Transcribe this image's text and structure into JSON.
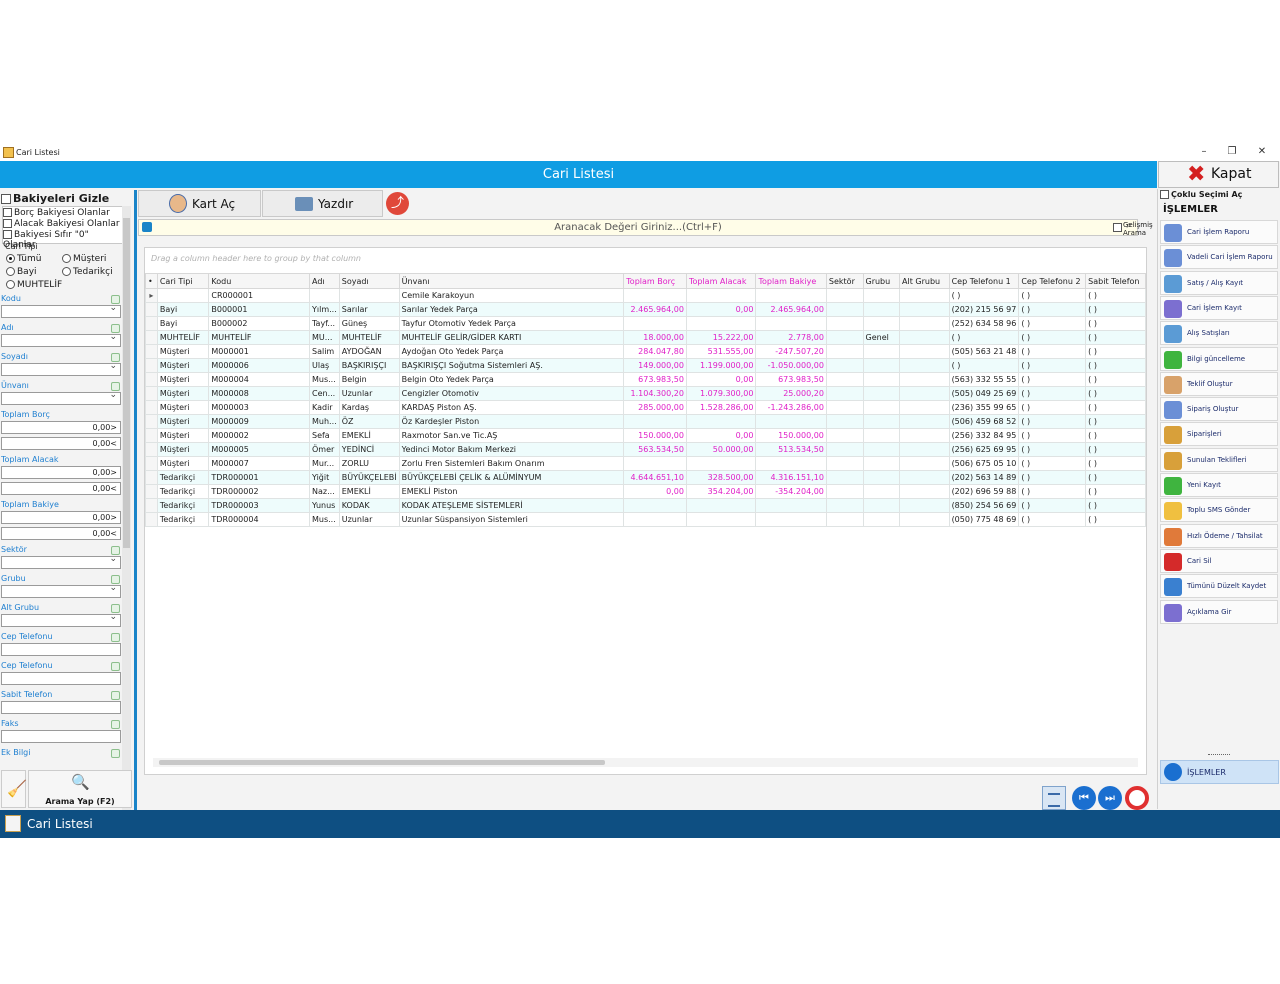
{
  "window": {
    "title": "Cari Listesi",
    "header": "Cari Listesi",
    "close_label": "Kapat"
  },
  "left": {
    "hide_balances": "Bakiyeleri Gizle",
    "filters": [
      "Borç Bakiyesi Olanlar",
      "Alacak Bakiyesi Olanlar",
      "Bakiyesi Sıfır \"0\" Olanlar"
    ],
    "cari_tipi_label": "Cari Tipi",
    "radios": [
      "Tümü",
      "Müşteri",
      "Bayi",
      "Tedarikçi",
      "MUHTELİF"
    ],
    "fields": [
      {
        "label": "Kodu",
        "type": "dd"
      },
      {
        "label": "Adı",
        "type": "dd"
      },
      {
        "label": "Soyadı",
        "type": "dd"
      },
      {
        "label": "Ünvanı",
        "type": "dd"
      },
      {
        "label": "Toplam Borç",
        "type": "range",
        "v1": "0,00>",
        "v2": "0,00<"
      },
      {
        "label": "Toplam Alacak",
        "type": "range",
        "v1": "0,00>",
        "v2": "0,00<"
      },
      {
        "label": "Toplam Bakiye",
        "type": "range",
        "v1": "0,00>",
        "v2": "0,00<"
      },
      {
        "label": "Sektör",
        "type": "dd"
      },
      {
        "label": "Grubu",
        "type": "dd"
      },
      {
        "label": "Alt Grubu",
        "type": "dd"
      },
      {
        "label": "Cep Telefonu",
        "type": "text"
      },
      {
        "label": "Cep Telefonu",
        "type": "text"
      },
      {
        "label": "Sabit Telefon",
        "type": "text"
      },
      {
        "label": "Faks",
        "type": "text"
      },
      {
        "label": "Ek Bilgi",
        "type": "text"
      }
    ],
    "search_button": "Arama Yap (F2)"
  },
  "toolbar": {
    "open_card": "Kart Aç",
    "print": "Yazdır",
    "search_placeholder": "Aranacak Değeri Giriniz...(Ctrl+F)",
    "advanced": "Gelişmiş Arama"
  },
  "grid": {
    "groupby_hint": "Drag a column header here to group by that column",
    "columns": [
      "Cari Tipi",
      "Kodu",
      "Adı",
      "Soyadı",
      "Ünvanı",
      "Toplam Borç",
      "Toplam Alacak",
      "Toplam Bakiye",
      "Sektör",
      "Grubu",
      "Alt Grubu",
      "Cep Telefonu 1",
      "Cep Telefonu 2",
      "Sabit Telefon"
    ],
    "rows": [
      [
        "",
        "CR000001",
        "",
        "",
        "Cemile Karakoyun",
        "",
        "",
        "",
        "",
        "",
        "",
        "( )",
        "( )",
        "( )"
      ],
      [
        "Bayi",
        "B000001",
        "Yılm...",
        "Sarılar",
        "Sarılar Yedek Parça",
        "2.465.964,00",
        "0,00",
        "2.465.964,00",
        "",
        "",
        "",
        "(202) 215 56 97",
        "( )",
        "( )"
      ],
      [
        "Bayi",
        "B000002",
        "Tayf...",
        "Güneş",
        "Tayfur Otomotiv Yedek Parça",
        "",
        "",
        "",
        "",
        "",
        "",
        "(252) 634 58 96",
        "( )",
        "( )"
      ],
      [
        "MUHTELİF",
        "MUHTELİF",
        "MU...",
        "MUHTELİF",
        "MUHTELİF GELİR/GİDER KARTI",
        "18.000,00",
        "15.222,00",
        "2.778,00",
        "",
        "Genel",
        "",
        "( )",
        "( )",
        "( )"
      ],
      [
        "Müşteri",
        "M000001",
        "Salim",
        "AYDOĞAN",
        "Aydoğan Oto Yedek Parça",
        "284.047,80",
        "531.555,00",
        "-247.507,20",
        "",
        "",
        "",
        "(505) 563 21 48",
        "( )",
        "( )"
      ],
      [
        "Müşteri",
        "M000006",
        "Ulaş",
        "BAŞKIRIŞÇI",
        "BAŞKIRIŞÇI Soğutma Sistemleri AŞ.",
        "149.000,00",
        "1.199.000,00",
        "-1.050.000,00",
        "",
        "",
        "",
        "( )",
        "( )",
        "( )"
      ],
      [
        "Müşteri",
        "M000004",
        "Mus...",
        "Belgin",
        "Belgin Oto Yedek Parça",
        "673.983,50",
        "0,00",
        "673.983,50",
        "",
        "",
        "",
        "(563) 332 55 55",
        "( )",
        "( )"
      ],
      [
        "Müşteri",
        "M000008",
        "Cen...",
        "Uzunlar",
        "Cengizler Otomotiv",
        "1.104.300,20",
        "1.079.300,00",
        "25.000,20",
        "",
        "",
        "",
        "(505) 049 25 69",
        "( )",
        "( )"
      ],
      [
        "Müşteri",
        "M000003",
        "Kadir",
        "Kardaş",
        "KARDAŞ Piston AŞ.",
        "285.000,00",
        "1.528.286,00",
        "-1.243.286,00",
        "",
        "",
        "",
        "(236) 355 99 65",
        "( )",
        "( )"
      ],
      [
        "Müşteri",
        "M000009",
        "Muh...",
        "ÖZ",
        "Öz Kardeşler Piston",
        "",
        "",
        "",
        "",
        "",
        "",
        "(506) 459 68 52",
        "( )",
        "( )"
      ],
      [
        "Müşteri",
        "M000002",
        "Sefa",
        "EMEKLİ",
        "Raxmotor San.ve Tic.AŞ",
        "150.000,00",
        "0,00",
        "150.000,00",
        "",
        "",
        "",
        "(256) 332 84 95",
        "( )",
        "( )"
      ],
      [
        "Müşteri",
        "M000005",
        "Ömer",
        "YEDİNCİ",
        "Yedinci Motor Bakım Merkezi",
        "563.534,50",
        "50.000,00",
        "513.534,50",
        "",
        "",
        "",
        "(256) 625 69 95",
        "( )",
        "( )"
      ],
      [
        "Müşteri",
        "M000007",
        "Mur...",
        "ZORLU",
        "Zorlu Fren Sistemleri Bakım Onarım",
        "",
        "",
        "",
        "",
        "",
        "",
        "(506) 675 05 10",
        "( )",
        "( )"
      ],
      [
        "Tedarikçi",
        "TDR000001",
        "Yiğit",
        "BÜYÜKÇELEBİ",
        "BÜYÜKÇELEBİ ÇELİK & ALÜMİNYUM",
        "4.644.651,10",
        "328.500,00",
        "4.316.151,10",
        "",
        "",
        "",
        "(202) 563 14 89",
        "( )",
        "( )"
      ],
      [
        "Tedarikçi",
        "TDR000002",
        "Naz...",
        "EMEKLİ",
        "EMEKLİ Piston",
        "0,00",
        "354.204,00",
        "-354.204,00",
        "",
        "",
        "",
        "(202) 696 59 88",
        "( )",
        "( )"
      ],
      [
        "Tedarikçi",
        "TDR000003",
        "Yunus",
        "KODAK",
        "KODAK ATEŞLEME SİSTEMLERİ",
        "",
        "",
        "",
        "",
        "",
        "",
        "(850) 254 56 69",
        "( )",
        "( )"
      ],
      [
        "Tedarikçi",
        "TDR000004",
        "Mus...",
        "Uzunlar",
        "Uzunlar Süspansiyon Sistemleri",
        "",
        "",
        "",
        "",
        "",
        "",
        "(050) 775 48 69",
        "( )",
        "( )"
      ]
    ]
  },
  "right": {
    "multi_select": "Çoklu Seçimi Aç",
    "section": "İŞLEMLER",
    "items": [
      {
        "label": "Cari İşlem Raporu",
        "color": "#6b8fd6"
      },
      {
        "label": "Vadeli Cari İşlem Raporu",
        "color": "#6b8fd6"
      },
      {
        "label": "Satış / Alış Kayıt",
        "color": "#5b9bd5"
      },
      {
        "label": "Cari İşlem Kayıt",
        "color": "#7c6fd0"
      },
      {
        "label": "Alış Satışları",
        "color": "#5b9bd5"
      },
      {
        "label": "Bilgi güncelleme",
        "color": "#3fb43f"
      },
      {
        "label": "Teklif Oluştur",
        "color": "#d8a26a"
      },
      {
        "label": "Sipariş Oluştur",
        "color": "#6b8fd6"
      },
      {
        "label": "Siparişleri",
        "color": "#d8a03a"
      },
      {
        "label": "Sunulan Teklifleri",
        "color": "#d8a03a"
      },
      {
        "label": "Yeni Kayıt",
        "color": "#3fb43f"
      },
      {
        "label": "Toplu SMS Gönder",
        "color": "#f0c040"
      },
      {
        "label": "Hızlı Ödeme / Tahsilat",
        "color": "#e07a3a"
      },
      {
        "label": "Cari Sil",
        "color": "#d42a2a"
      },
      {
        "label": "Tümünü Düzelt Kaydet",
        "color": "#3a80d0"
      },
      {
        "label": "Açıklama Gir",
        "color": "#7c6fd0"
      }
    ],
    "footer": "İŞLEMLER"
  },
  "statusbar": {
    "title": "Cari Listesi"
  }
}
